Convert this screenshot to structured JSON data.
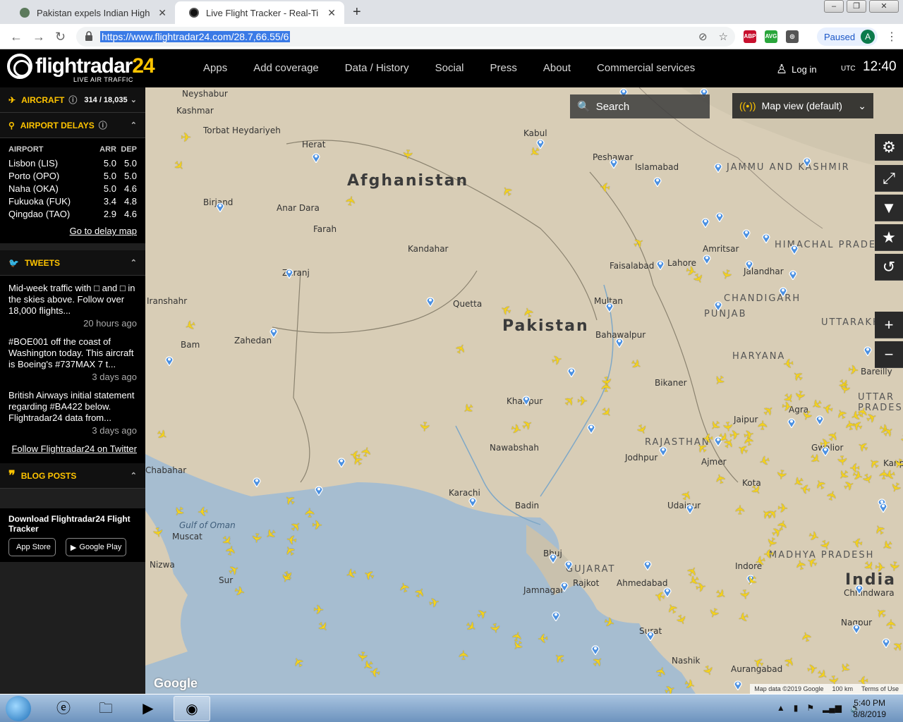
{
  "browser": {
    "tabs": [
      {
        "title": "Pakistan expels Indian High Com",
        "active": false
      },
      {
        "title": "Live Flight Tracker - Real-Time Fli",
        "active": true
      }
    ],
    "url": "https://www.flightradar24.com/28.7,66.55/6",
    "paused_label": "Paused",
    "avatar_letter": "A",
    "extensions": [
      "ABP",
      "AVG"
    ],
    "ext_badge": "4"
  },
  "header": {
    "logo_word": "flightradar",
    "logo_num": "24",
    "logo_sub": "LIVE AIR TRAFFIC",
    "nav": [
      "Apps",
      "Add coverage",
      "Data / History",
      "Social",
      "Press",
      "About",
      "Commercial services"
    ],
    "login": "Log in",
    "utc": "UTC",
    "time": "12:40"
  },
  "sidebar": {
    "aircraft_label": "AIRCRAFT",
    "aircraft_count": "314 / 18,035",
    "delays_label": "AIRPORT DELAYS",
    "delay_cols": {
      "airport": "AIRPORT",
      "arr": "ARR",
      "dep": "DEP"
    },
    "delays": [
      {
        "name": "Lisbon (LIS)",
        "arr": "5.0",
        "dep": "5.0"
      },
      {
        "name": "Porto (OPO)",
        "arr": "5.0",
        "dep": "5.0"
      },
      {
        "name": "Naha (OKA)",
        "arr": "5.0",
        "dep": "4.6"
      },
      {
        "name": "Fukuoka (FUK)",
        "arr": "3.4",
        "dep": "4.8"
      },
      {
        "name": "Qingdao (TAO)",
        "arr": "2.9",
        "dep": "4.6"
      }
    ],
    "delay_link": "Go to delay map",
    "tweets_label": "TWEETS",
    "tweets": [
      {
        "text": "Mid-week traffic with □ and □ in the skies above. Follow over 18,000 flights...",
        "ago": "20 hours ago"
      },
      {
        "text": "#BOE001 off the coast of Washington today. This aircraft is Boeing's #737MAX 7 t...",
        "ago": "3 days ago"
      },
      {
        "text": "British Airways initial statement regarding #BA422 below. Flightradar24 data from...",
        "ago": "3 days ago"
      }
    ],
    "tweet_link": "Follow Flightradar24 on Twitter",
    "blog_label": "BLOG POSTS",
    "download_label": "Download Flightradar24 Flight Tracker",
    "app_store": "App Store",
    "google_play": "Google Play"
  },
  "map": {
    "search_label": "Search",
    "map_view_label": "Map view (default)",
    "attribution": "Map data ©2019 Google",
    "scale": "100 km",
    "terms": "Terms of Use",
    "google": "Google",
    "countries": [
      "Afghanistan",
      "Pakistan",
      "India"
    ],
    "cities": [
      "Kabul",
      "Herat",
      "Kandahar",
      "Quetta",
      "Islamabad",
      "Lahore",
      "Faisalabad",
      "Multan",
      "Peshawar",
      "Karachi",
      "Zahedan",
      "Birjand",
      "Bam",
      "Muscat",
      "Jaipur",
      "Agra",
      "Jodhpur",
      "Ajmer",
      "Bikaner",
      "Ahmedabad",
      "Rajkot",
      "Jamnagar",
      "Indore",
      "Nagpur",
      "Nashik",
      "Surat",
      "Udaipur",
      "Kota",
      "Gwalior",
      "Kanpur",
      "Bareilly",
      "Chhindwara",
      "Aurangabad",
      "Bhuj",
      "Badin",
      "Nawabshah",
      "Khairpur",
      "Bahawalpur",
      "Amritsar",
      "Jalandhar",
      "Farah",
      "Anar Dara",
      "Torbat Heydariyeh",
      "Neyshabur",
      "Kashmar",
      "Nizwa",
      "Sur",
      "Chabahar",
      "Zaranj",
      "Iranshahr"
    ],
    "regions": [
      "PUNJAB",
      "HARYANA",
      "RAJASTHAN",
      "GUJARAT",
      "UTTARAKHAND",
      "UTTAR PRADESH",
      "MADHYA PRADESH",
      "HIMACHAL PRADESH",
      "JAMMU AND KASHMIR",
      "CHANDIGARH"
    ],
    "water_labels": [
      "Gulf of Oman"
    ]
  },
  "taskbar": {
    "time": "5:40 PM",
    "date": "8/8/2019"
  }
}
